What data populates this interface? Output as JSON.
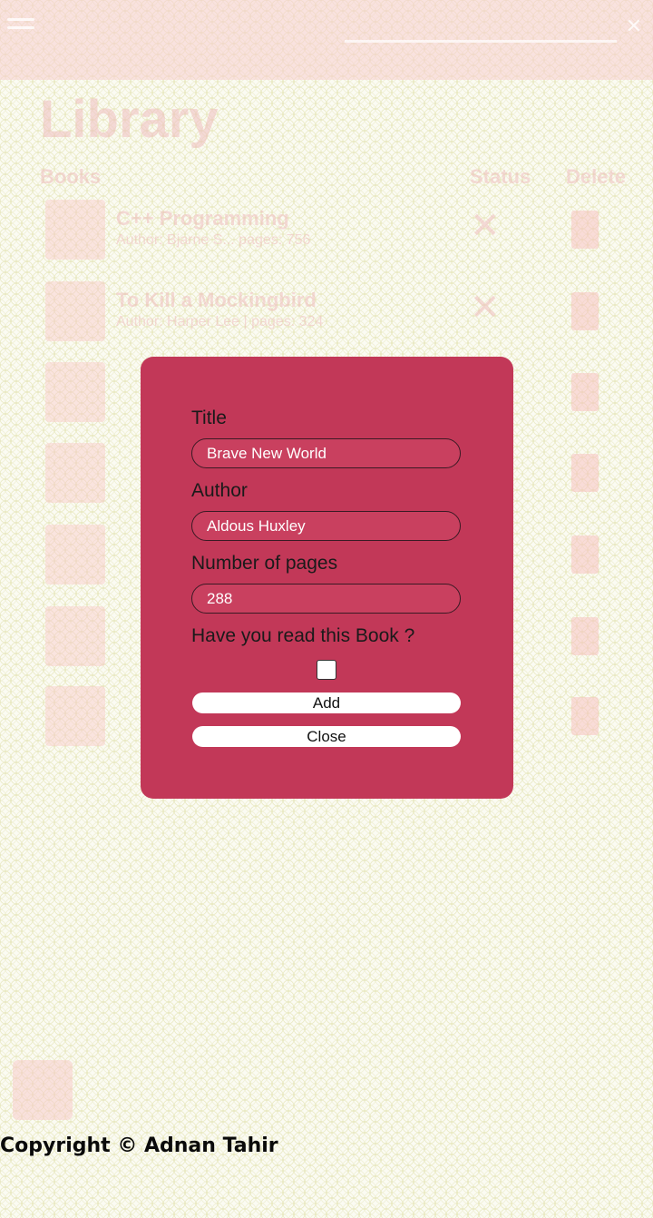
{
  "page": {
    "title": "Library",
    "columns": {
      "books": "Books",
      "status": "Status",
      "delete": "Delete"
    },
    "books": [
      {
        "title": "C++ Programming",
        "meta": "Author: Bjarne S... pages: 756"
      },
      {
        "title": "To Kill a Mockingbird",
        "meta": "Author: Harper Lee | pages: 324"
      },
      {
        "title": "",
        "meta": ""
      },
      {
        "title": "",
        "meta": ""
      },
      {
        "title": "",
        "meta": ""
      },
      {
        "title": "",
        "meta": ""
      },
      {
        "title": "",
        "meta": ""
      }
    ]
  },
  "modal": {
    "title_label": "Title",
    "title_value": "Brave New World",
    "author_label": "Author",
    "author_value": "Aldous Huxley",
    "pages_label": "Number of pages",
    "pages_value": "288",
    "read_label": "Have you read this Book ?",
    "read_checked": false,
    "add_label": "Add",
    "close_label": "Close"
  },
  "footer": {
    "text": "Copyright © Adnan Tahir"
  },
  "colors": {
    "modal_bg": "#c23858",
    "field_bg": "#c9405f",
    "accent_faded": "#f8c8c8"
  }
}
